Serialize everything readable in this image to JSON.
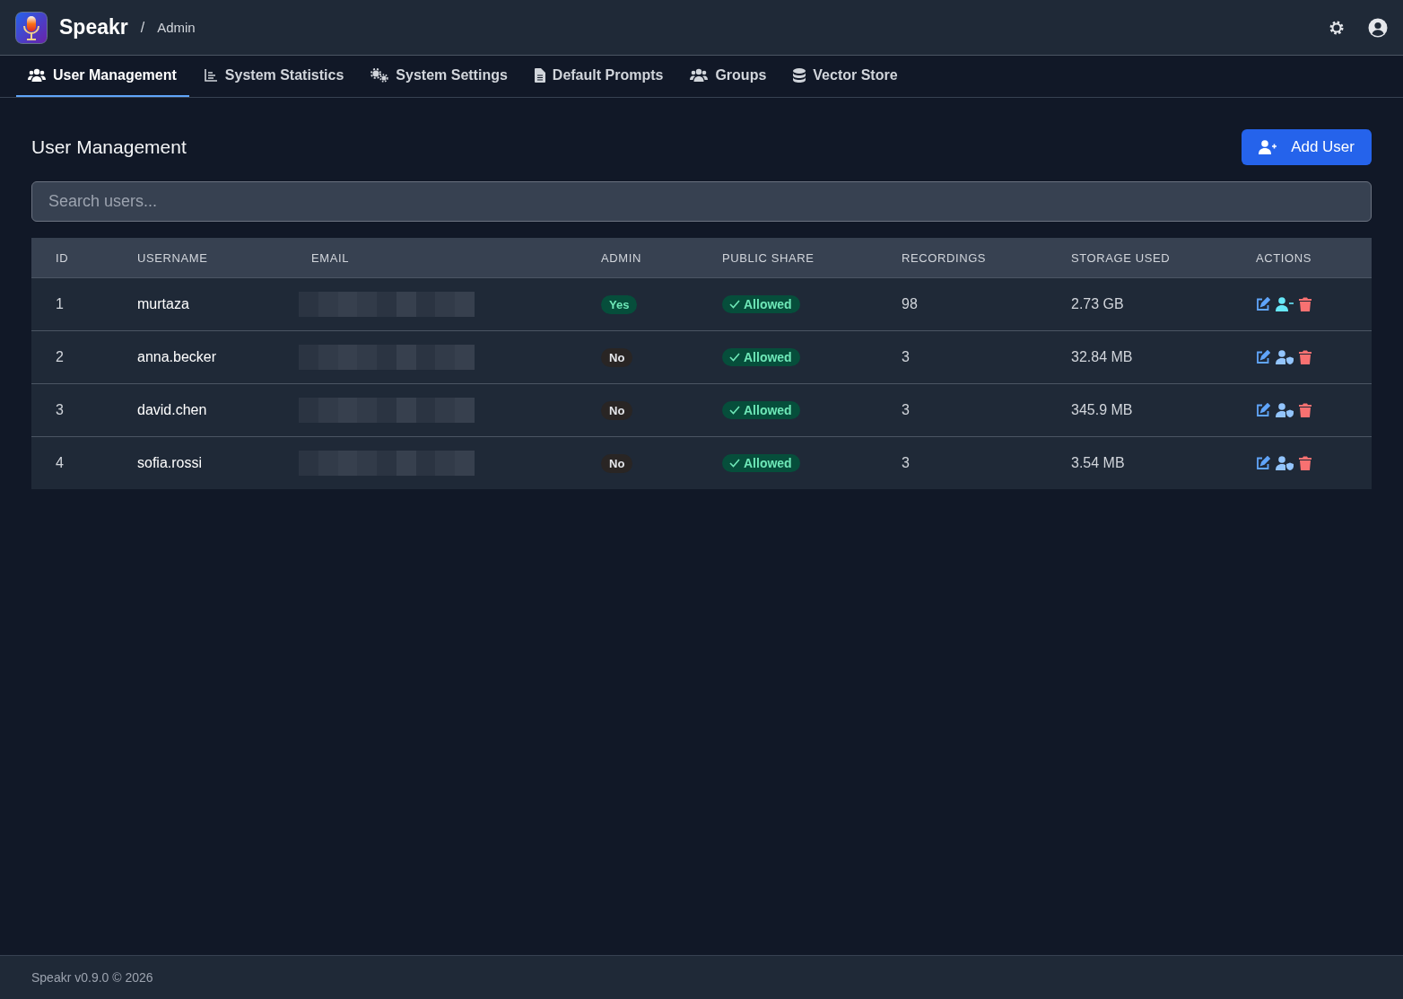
{
  "header": {
    "app_name": "Speakr",
    "separator": "/",
    "section": "Admin"
  },
  "tabs": [
    {
      "label": "User Management",
      "kind": "users",
      "selected": true
    },
    {
      "label": "System Statistics",
      "kind": "chart",
      "selected": false
    },
    {
      "label": "System Settings",
      "kind": "gears",
      "selected": false
    },
    {
      "label": "Default Prompts",
      "kind": "file",
      "selected": false
    },
    {
      "label": "Groups",
      "kind": "users",
      "selected": false
    },
    {
      "label": "Vector Store",
      "kind": "database",
      "selected": false
    }
  ],
  "page_title": "User Management",
  "add_button": "Add User",
  "search": {
    "placeholder": "Search users..."
  },
  "table": {
    "columns": [
      "ID",
      "USERNAME",
      "EMAIL",
      "ADMIN",
      "PUBLIC SHARE",
      "RECORDINGS",
      "STORAGE USED",
      "ACTIONS"
    ],
    "rows": [
      {
        "id": "1",
        "username": "murtaza",
        "email": {
          "kind": "redacted"
        },
        "admin": {
          "label": "Yes",
          "on": true
        },
        "public_share": {
          "label": "Allowed",
          "on": true
        },
        "recordings": "98",
        "storage": "2.73 GB"
      },
      {
        "id": "2",
        "username": "anna.becker",
        "email": {
          "kind": "redacted"
        },
        "admin": {
          "label": "No",
          "on": false
        },
        "public_share": {
          "label": "Allowed",
          "on": true
        },
        "recordings": "3",
        "storage": "32.84 MB"
      },
      {
        "id": "3",
        "username": "david.chen",
        "email": {
          "kind": "redacted"
        },
        "admin": {
          "label": "No",
          "on": false
        },
        "public_share": {
          "label": "Allowed",
          "on": true
        },
        "recordings": "3",
        "storage": "345.9 MB"
      },
      {
        "id": "4",
        "username": "sofia.rossi",
        "email": {
          "kind": "redacted"
        },
        "admin": {
          "label": "No",
          "on": false
        },
        "public_share": {
          "label": "Allowed",
          "on": true
        },
        "recordings": "3",
        "storage": "3.54 MB"
      }
    ]
  },
  "footer": "Speakr v0.9.0 © 2026"
}
